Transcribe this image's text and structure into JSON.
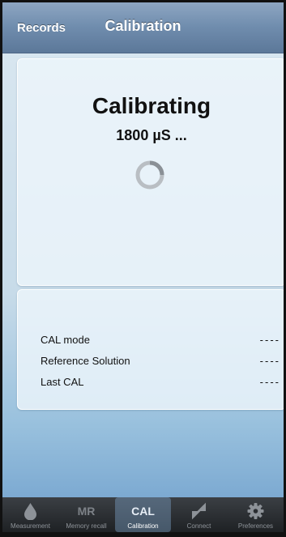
{
  "navbar": {
    "back_label": "Records",
    "title": "Calibration"
  },
  "status": {
    "title": "Calibrating",
    "subtitle": "1800 µS ..."
  },
  "info": {
    "rows": [
      {
        "label": "CAL mode",
        "value": "----"
      },
      {
        "label": "Reference Solution",
        "value": "----"
      },
      {
        "label": "Last CAL",
        "value": "----"
      }
    ]
  },
  "tabbar": {
    "tabs": [
      {
        "icon": "drop-icon",
        "label": "Measurement",
        "icon_text": ""
      },
      {
        "icon": "mr-text-icon",
        "label": "Memory recall",
        "icon_text": "MR"
      },
      {
        "icon": "cal-text-icon",
        "label": "Calibration",
        "icon_text": "CAL",
        "active": true
      },
      {
        "icon": "connect-arrows-icon",
        "label": "Connect",
        "icon_text": ""
      },
      {
        "icon": "gear-icon",
        "label": "Preferences",
        "icon_text": ""
      }
    ]
  }
}
